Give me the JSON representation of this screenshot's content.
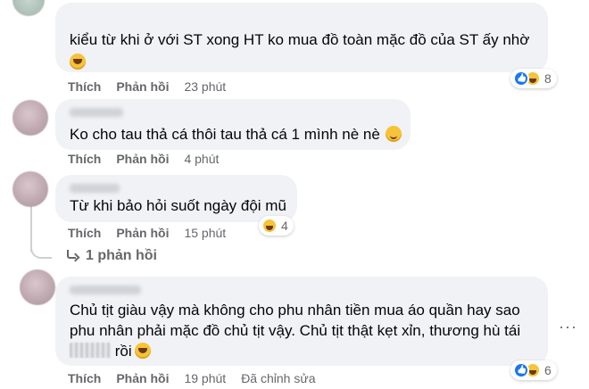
{
  "comments": [
    {
      "text_lines": [
        "kiểu từ khi ở với ST xong HT ko mua đồ toàn mặc đồ của ST ấy nhờ"
      ],
      "emoji": "haha-emoji",
      "actions": {
        "like": "Thích",
        "reply": "Phản hồi",
        "time": "23 phút"
      },
      "reactions": {
        "icons": [
          "like",
          "haha"
        ],
        "count": "8"
      }
    },
    {
      "text_lines": [
        "Ko cho tau thả cá thôi tau thả cá 1 mình nè nè"
      ],
      "emoji": "smile-emoji",
      "actions": {
        "like": "Thích",
        "reply": "Phản hồi",
        "time": "4 phút"
      }
    },
    {
      "text_lines": [
        "Từ khi bảo hỏi suốt ngày đội mũ"
      ],
      "actions": {
        "like": "Thích",
        "reply": "Phản hồi",
        "time": "15 phút"
      },
      "reactions": {
        "icons": [
          "haha"
        ],
        "count": "4"
      },
      "replies_link": "1 phản hồi"
    },
    {
      "text_lines": [
        "Chủ tịt giàu vậy mà không cho phu nhân tiền mua áo quần hay sao",
        "phu nhân phải mặc đồ chủ tịt vậy. Chủ tịt thật kẹt xỉn, thương hù tái",
        "rồi"
      ],
      "emoji": "rofl-emoji",
      "actions": {
        "like": "Thích",
        "reply": "Phản hồi",
        "time": "19 phút",
        "edited": "Đã chỉnh sửa"
      },
      "reactions": {
        "icons": [
          "like",
          "haha"
        ],
        "count": "6"
      }
    }
  ],
  "more_options": "···",
  "colors": {
    "bubble": "#f0f2f5",
    "meta": "#65676b",
    "like_blue": "#1877f2",
    "haha_yellow": "#f7c338"
  }
}
